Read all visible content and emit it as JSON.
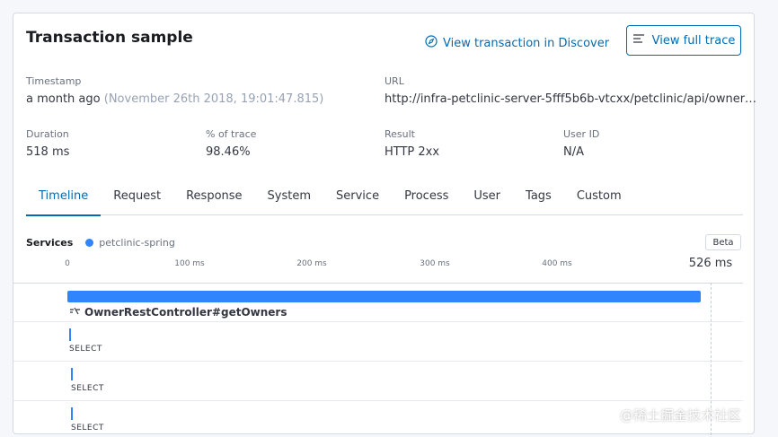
{
  "panel": {
    "title": "Transaction sample",
    "view_in_discover": "View transaction in Discover",
    "view_full_trace": "View full trace"
  },
  "meta": {
    "timestamp_label": "Timestamp",
    "timestamp_relative": "a month ago",
    "timestamp_absolute": "(November 26th 2018, 19:01:47.815)",
    "url_label": "URL",
    "url_value": "http://infra-petclinic-server-5fff5b6b-vtcxx/petclinic/api/owner…",
    "duration_label": "Duration",
    "duration_value": "518 ms",
    "pct_label": "% of trace",
    "pct_value": "98.46%",
    "result_label": "Result",
    "result_value": "HTTP 2xx",
    "userid_label": "User ID",
    "userid_value": "N/A"
  },
  "tabs": [
    "Timeline",
    "Request",
    "Response",
    "System",
    "Service",
    "Process",
    "User",
    "Tags",
    "Custom"
  ],
  "services": {
    "label": "Services",
    "items": [
      {
        "name": "petclinic-spring",
        "color": "#3185fc"
      }
    ],
    "beta": "Beta"
  },
  "timeline": {
    "ticks": [
      "0",
      "100 ms",
      "200 ms",
      "300 ms",
      "400 ms"
    ],
    "end_label": "526 ms",
    "main_span": {
      "name": "OwnerRestController#getOwners",
      "icon": "span-service-icon"
    },
    "child_spans": [
      "SELECT",
      "SELECT",
      "SELECT"
    ]
  },
  "watermark": "@稀土掘金技术社区",
  "colors": {
    "accent": "#006bb4",
    "span": "#3185fc"
  }
}
